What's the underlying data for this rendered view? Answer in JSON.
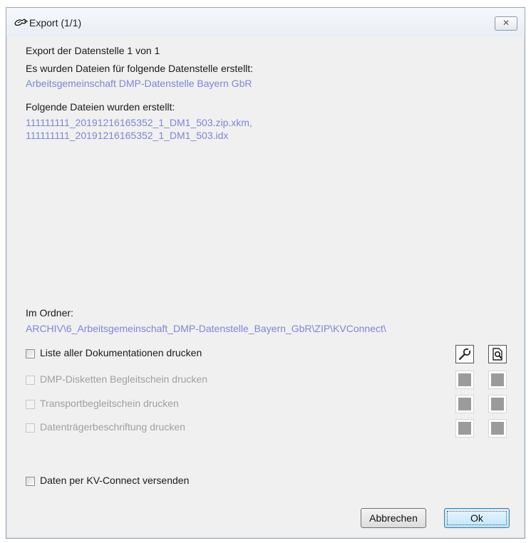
{
  "window": {
    "title": "Export (1/1)",
    "close_glyph": "✕"
  },
  "content": {
    "export_line": "Export der Datenstelle 1 von 1",
    "created_for_label": "Es wurden Dateien für folgende Datenstelle erstellt:",
    "datenstelle_name": "Arbeitsgemeinschaft DMP-Datenstelle Bayern GbR",
    "files_label": "Folgende Dateien wurden erstellt:",
    "files": [
      "111111111_20191216165352_1_DM1_503.zip.xkm,",
      "111111111_20191216165352_1_DM1_503.idx"
    ],
    "folder_label": "Im Ordner:",
    "folder_path": "ARCHIV\\6_Arbeitsgemeinschaft_DMP-Datenstelle_Bayern_GbR\\ZIP\\KVConnect\\"
  },
  "options": [
    {
      "label": "Liste aller Dokumentationen drucken",
      "enabled": true,
      "checked": false
    },
    {
      "label": "DMP-Disketten Begleitschein drucken",
      "enabled": false,
      "checked": false
    },
    {
      "label": "Transportbegleitschein drucken",
      "enabled": false,
      "checked": false
    },
    {
      "label": "Datenträgerbeschriftung drucken",
      "enabled": false,
      "checked": false
    }
  ],
  "kv_connect": {
    "label": "Daten per KV-Connect versenden",
    "checked": false
  },
  "buttons": {
    "cancel": "Abbrechen",
    "ok": "Ok"
  },
  "icons": {
    "title": "export-icon",
    "settings": "wrench-icon",
    "preview": "print-preview-icon"
  },
  "colors": {
    "link": "#7d86d6",
    "disabled_text": "#a0a0a0"
  }
}
